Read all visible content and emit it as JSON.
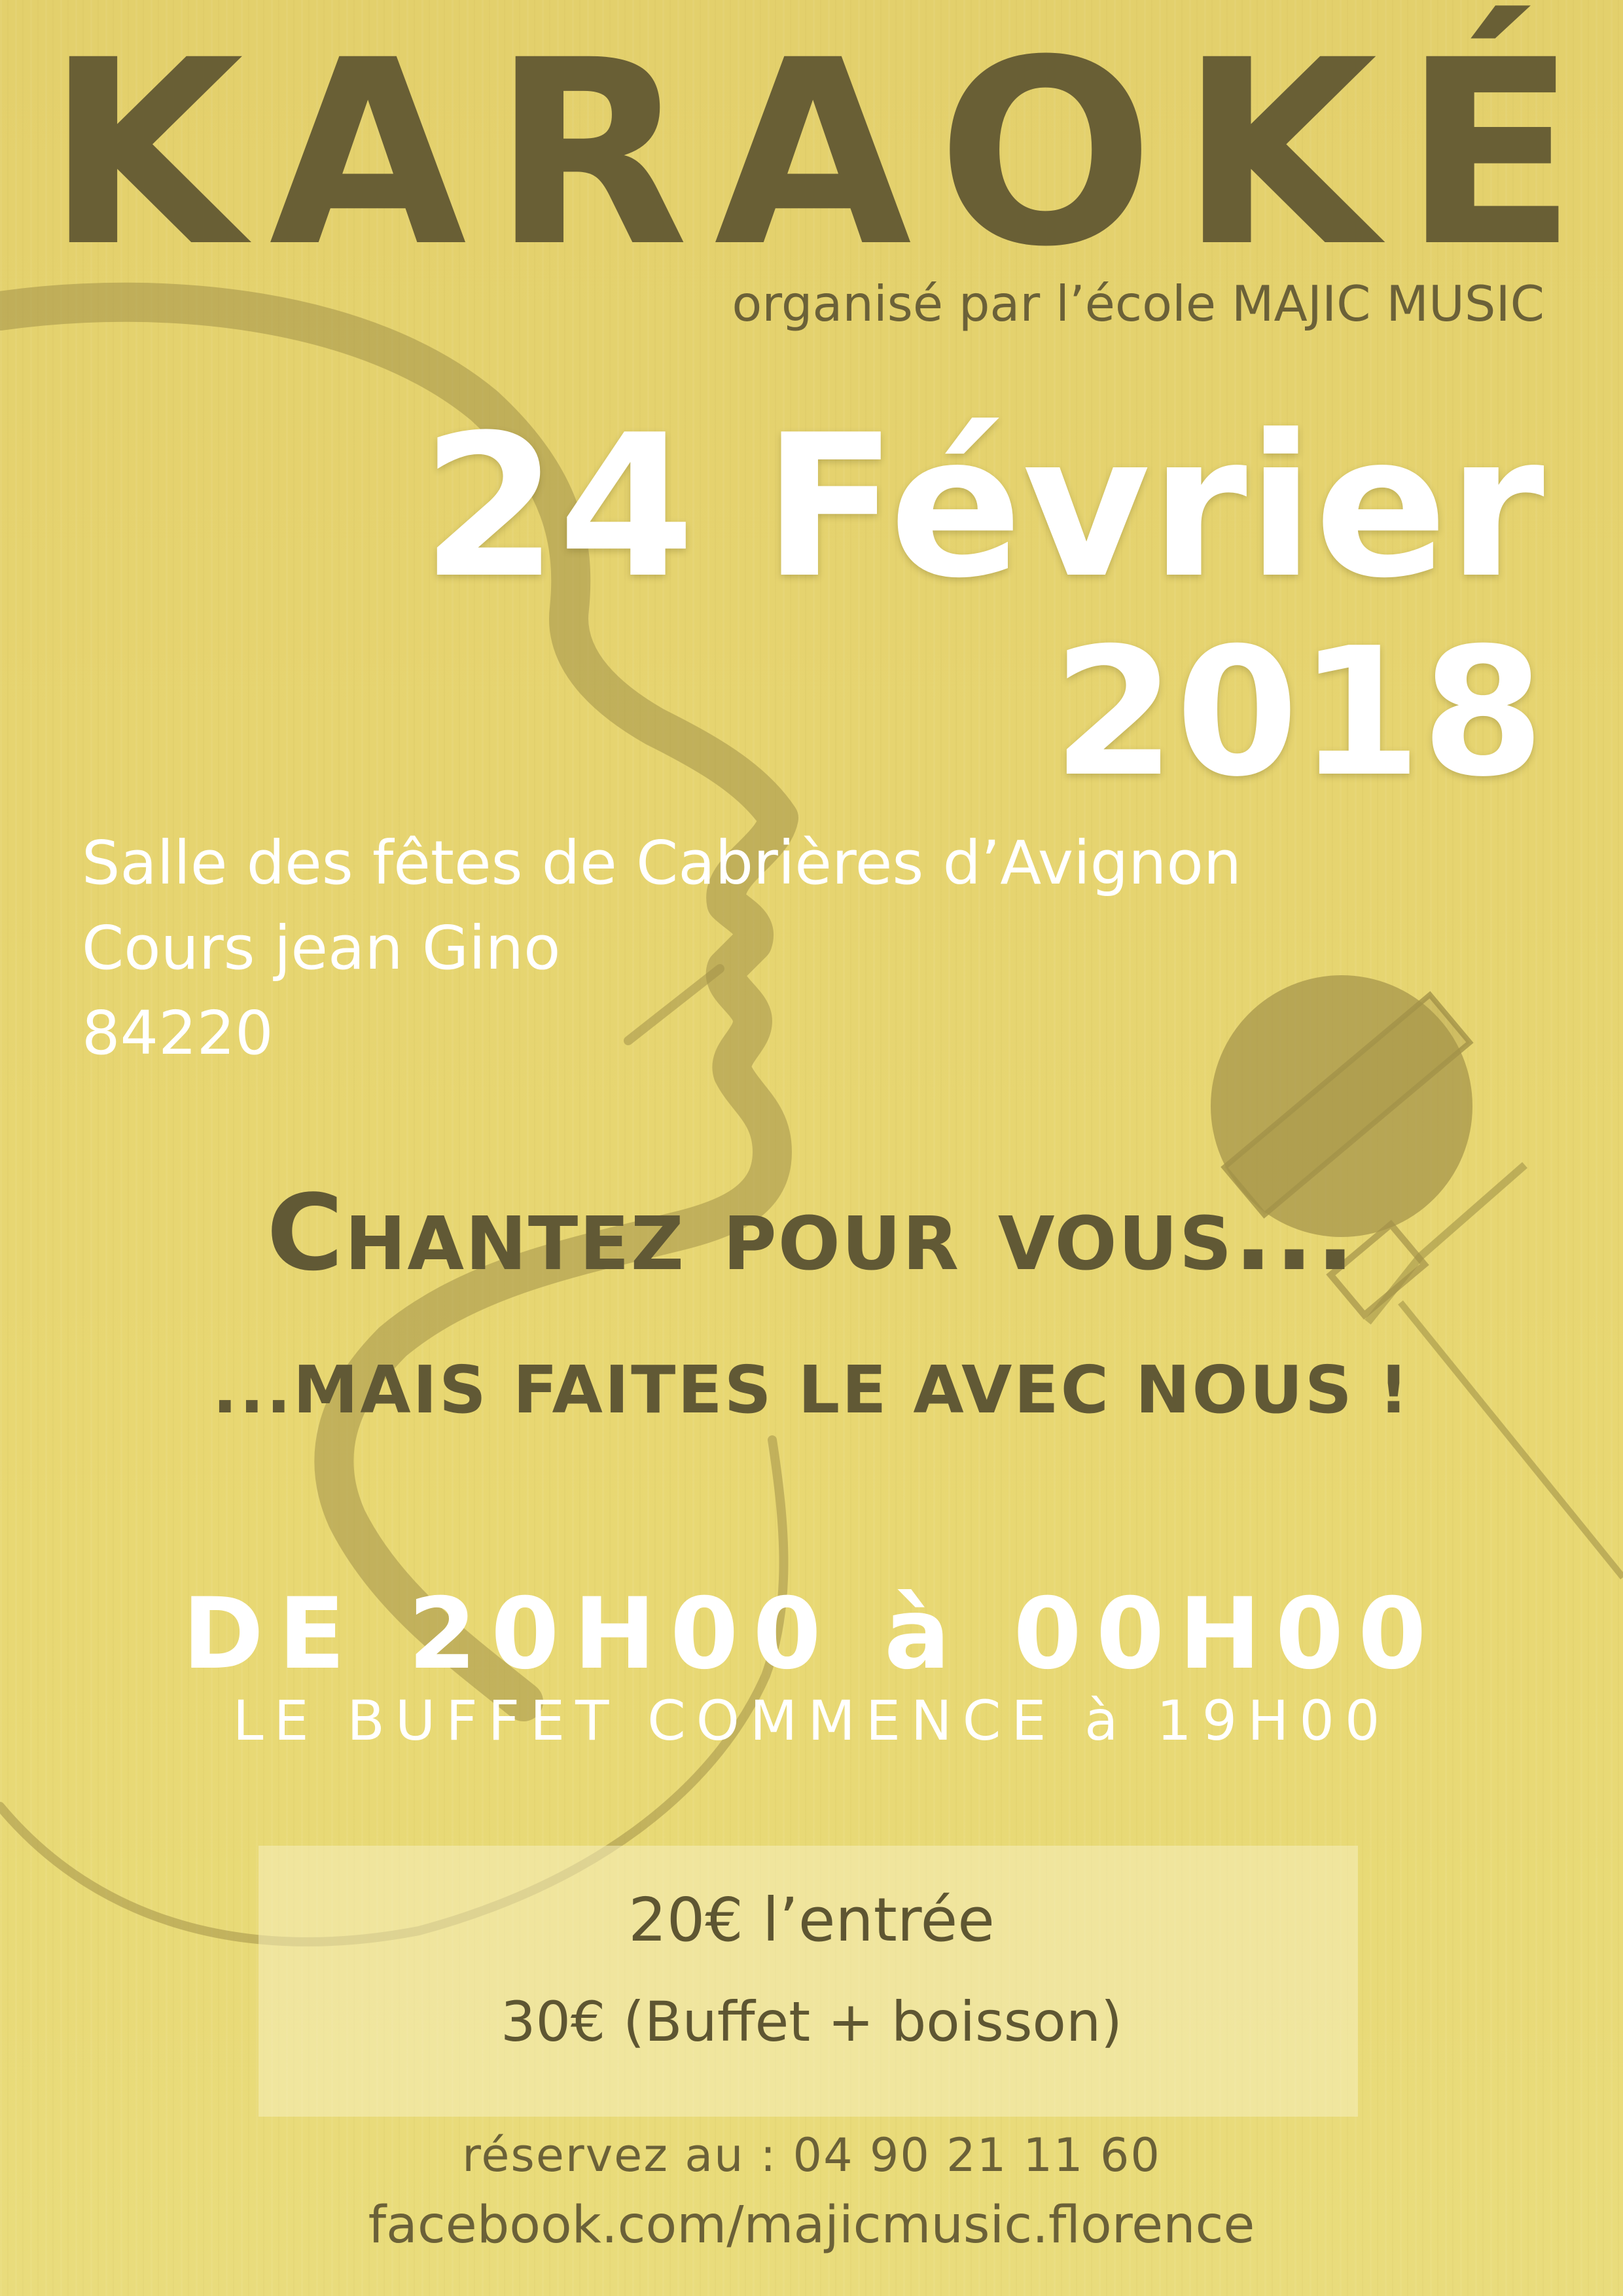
{
  "poster": {
    "title_letters": [
      "K",
      "A",
      "R",
      "A",
      "O",
      "K",
      "É"
    ],
    "organizer": "organisé par l’école MAJIC MUSIC",
    "date_line1": "24 Février",
    "date_line2": "2018",
    "address": {
      "line1": "Salle des fêtes de Cabrières d’Avignon",
      "line2": "Cours jean Gino",
      "line3": "84220"
    },
    "slogan1": "Chantez pour vous...",
    "slogan2": "...MAIS FAITES LE AVEC NOUS !",
    "hours": "DE 20H00 à 00H00",
    "buffet_start": "LE BUFFET COMMENCE à 19H00",
    "prices": {
      "entry": "20€ l’entrée",
      "buffet": "30€ (Buffet + boisson)"
    },
    "booking": "réservez au : 04 90 21 11 60",
    "facebook": "facebook.com/majicmusic.florence"
  },
  "icons": [
    "singer-silhouette-icon",
    "microphone-icon"
  ],
  "colors": {
    "background": "#e6d470",
    "dark_text": "#695f35",
    "light_text": "#ffffff",
    "silhouette": "#a29248"
  }
}
